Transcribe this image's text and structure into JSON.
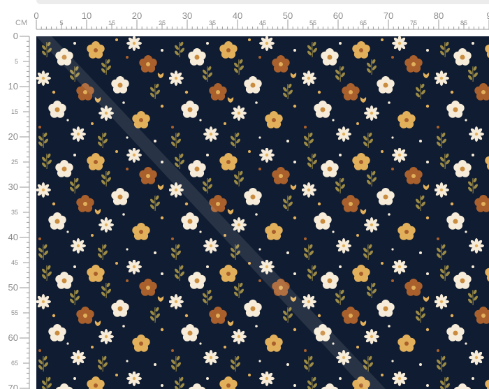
{
  "ruler": {
    "unit_label": "CM",
    "x_major": [
      "0",
      "10",
      "20",
      "30",
      "40",
      "50",
      "60",
      "70",
      "80",
      "9"
    ],
    "x_minor": [
      "5",
      "15",
      "25",
      "35",
      "45",
      "55",
      "65",
      "75",
      "85"
    ],
    "y_major": [
      "0",
      "10",
      "20",
      "30",
      "40",
      "50",
      "60",
      "70"
    ],
    "y_minor": [
      "5",
      "15",
      "25",
      "35",
      "45",
      "55",
      "65"
    ]
  },
  "fabric": {
    "background_color": "#101c31",
    "pattern": "floral",
    "colors": {
      "cream": "#f6ecd9",
      "mustard": "#e2b05b",
      "rust": "#a9602c",
      "olive": "#9c8b45",
      "center": "#c98b3e"
    }
  }
}
